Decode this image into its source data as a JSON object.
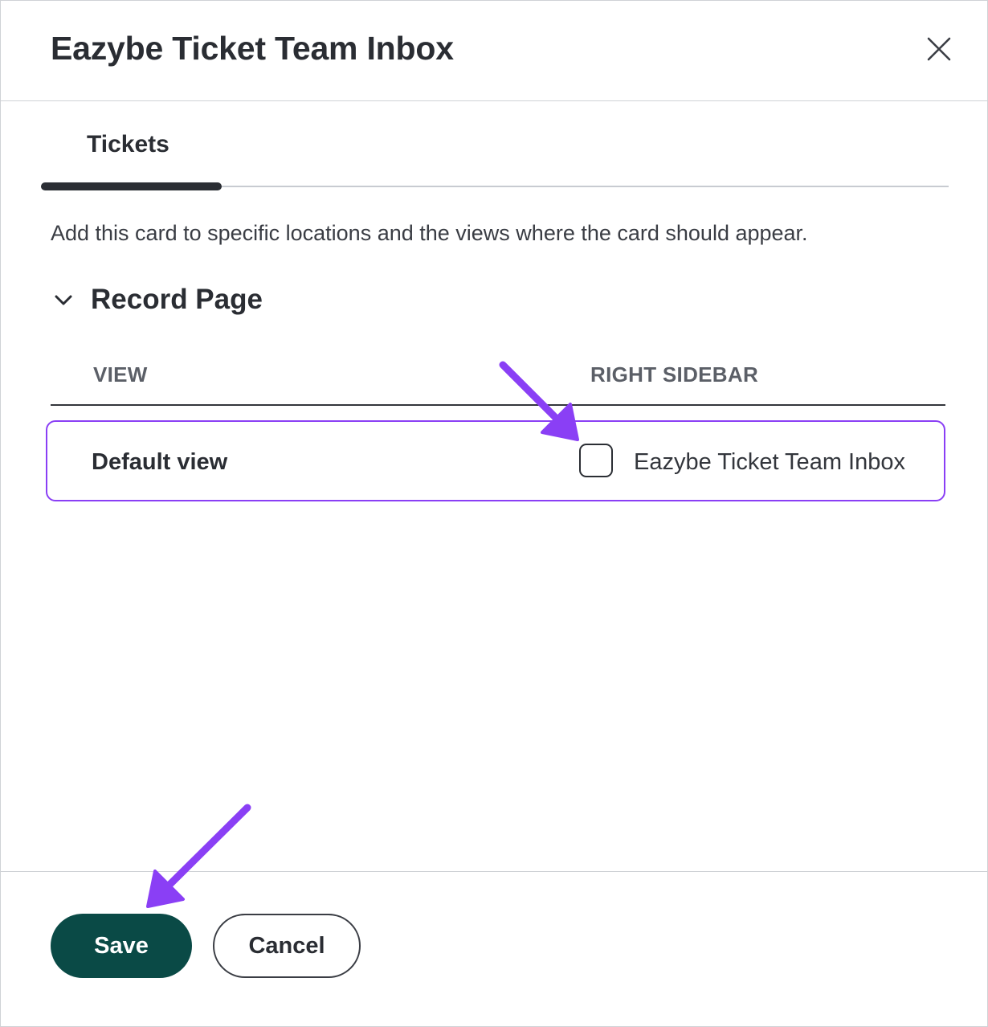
{
  "dialog": {
    "title": "Eazybe Ticket Team Inbox",
    "close_icon": "close-icon"
  },
  "tabs": [
    {
      "label": "Tickets",
      "active": true
    }
  ],
  "description": "Add this card to specific locations and the views where the card should appear.",
  "section": {
    "title": "Record Page",
    "expanded": true,
    "toggle_icon": "chevron-down-icon"
  },
  "table": {
    "columns": [
      "VIEW",
      "RIGHT SIDEBAR"
    ],
    "rows": [
      {
        "view": "Default view",
        "option_label": "Eazybe Ticket Team Inbox",
        "checked": false
      }
    ]
  },
  "footer": {
    "save_label": "Save",
    "cancel_label": "Cancel"
  },
  "colors": {
    "primary_button": "#0a4a46",
    "highlight": "#8a3ff5",
    "annotation_arrow": "#8a3ff5",
    "text": "#2a2d33"
  },
  "annotations": [
    {
      "type": "arrow",
      "icon": "annotation-arrow-icon",
      "points_to": "checkbox"
    },
    {
      "type": "arrow",
      "icon": "annotation-arrow-icon",
      "points_to": "save-button"
    }
  ]
}
